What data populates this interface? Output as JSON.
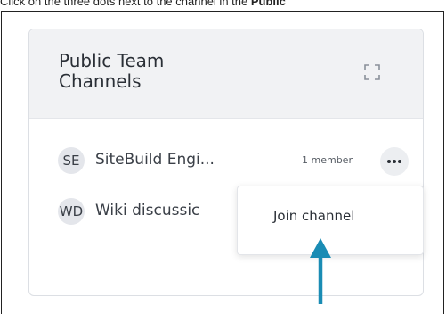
{
  "instruction": {
    "prefix": "Click on the three dots next to the channel in the ",
    "bold": "Public"
  },
  "card": {
    "title": "Public Team Channels",
    "expand_icon": "expand-icon"
  },
  "channels": [
    {
      "initials": "SE",
      "name": "SiteBuild Engi...",
      "members": "1 member"
    },
    {
      "initials": "WD",
      "name": "Wiki discussic"
    }
  ],
  "menu": {
    "items": [
      {
        "label": "Join channel"
      }
    ]
  },
  "colors": {
    "header_bg": "#f1f2f4",
    "avatar_bg": "#e4e6eb",
    "arrow": "#1a8cb4"
  }
}
